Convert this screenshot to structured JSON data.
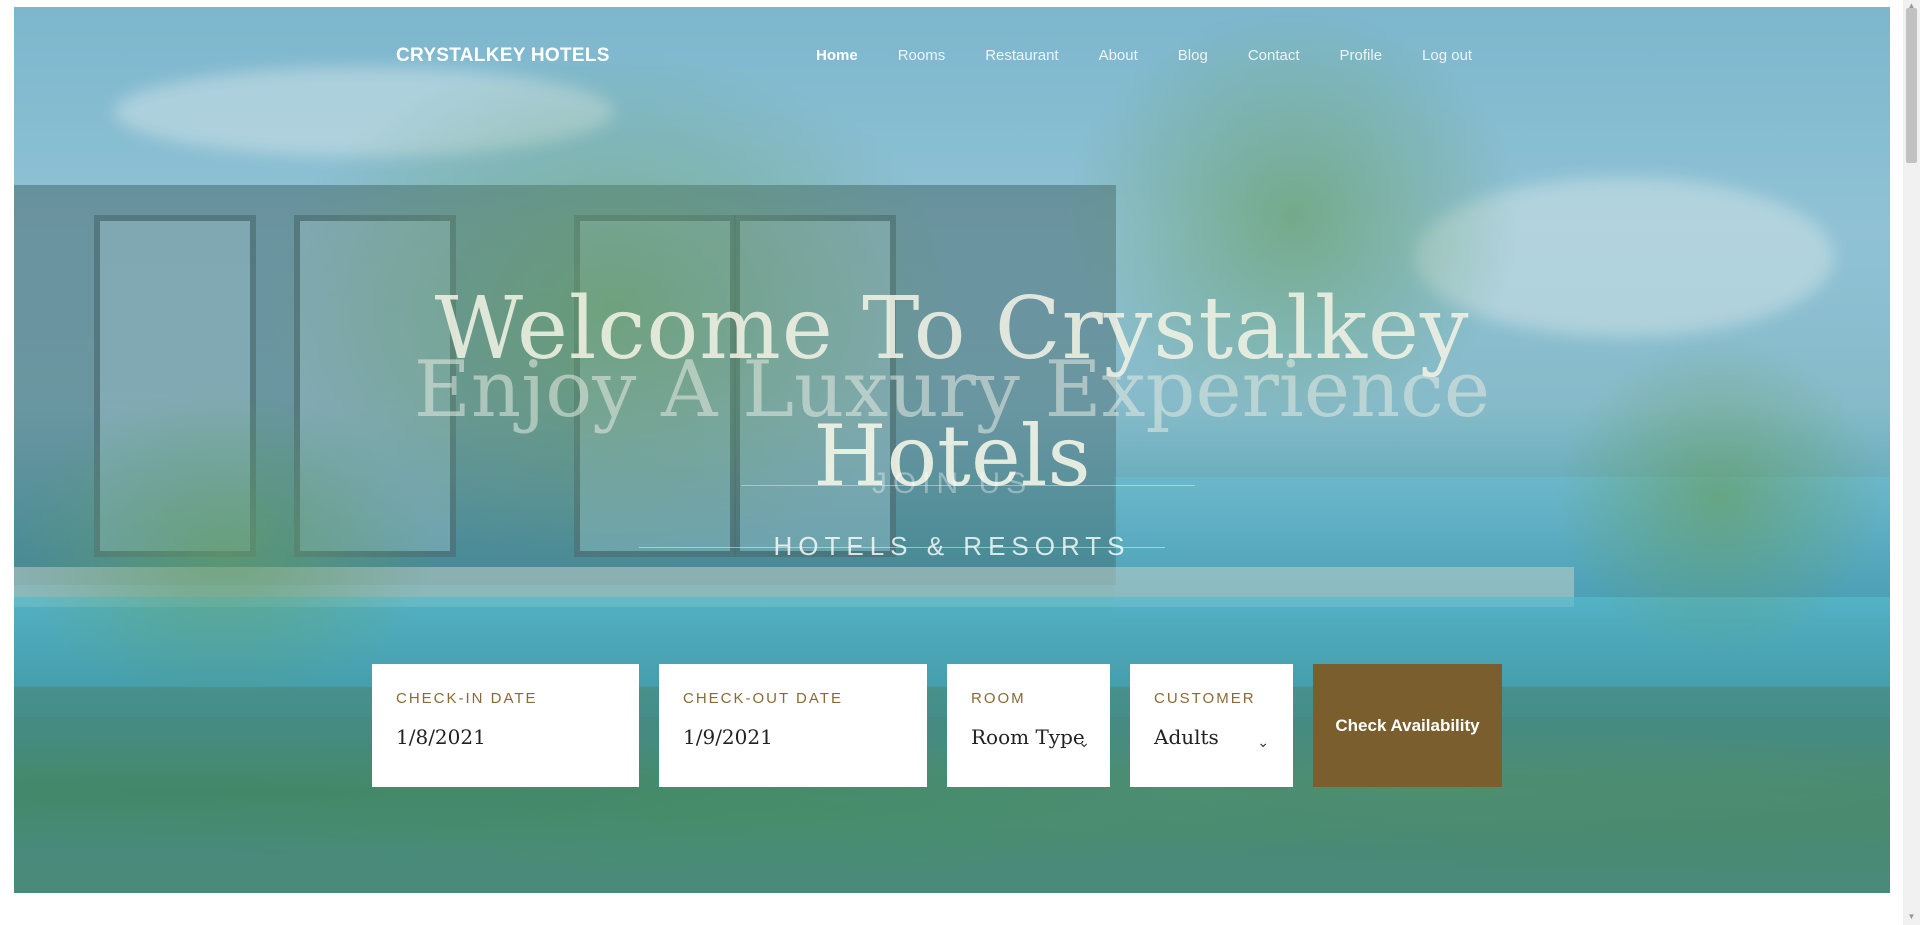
{
  "brand": "CRYSTALKEY HOTELS",
  "nav": {
    "items": [
      {
        "label": "Home",
        "active": true
      },
      {
        "label": "Rooms"
      },
      {
        "label": "Restaurant"
      },
      {
        "label": "About"
      },
      {
        "label": "Blog"
      },
      {
        "label": "Contact"
      },
      {
        "label": "Profile"
      },
      {
        "label": "Log out"
      }
    ]
  },
  "hero": {
    "title_line1": "Welcome To Crystalkey",
    "title_line2": "Enjoy A Luxury Experience",
    "title_line3": "Hotels",
    "join_text": "JOIN US",
    "subtitle": "HOTELS & RESORTS"
  },
  "booking": {
    "checkin": {
      "label": "CHECK-IN DATE",
      "value": "1/8/2021"
    },
    "checkout": {
      "label": "CHECK-OUT DATE",
      "value": "1/9/2021"
    },
    "room": {
      "label": "ROOM",
      "value": "Room Type"
    },
    "customer": {
      "label": "CUSTOMER",
      "value": "Adults"
    },
    "button_label": "Check Availability"
  },
  "colors": {
    "accent": "#7a5e2e",
    "label": "#8a6a34"
  }
}
